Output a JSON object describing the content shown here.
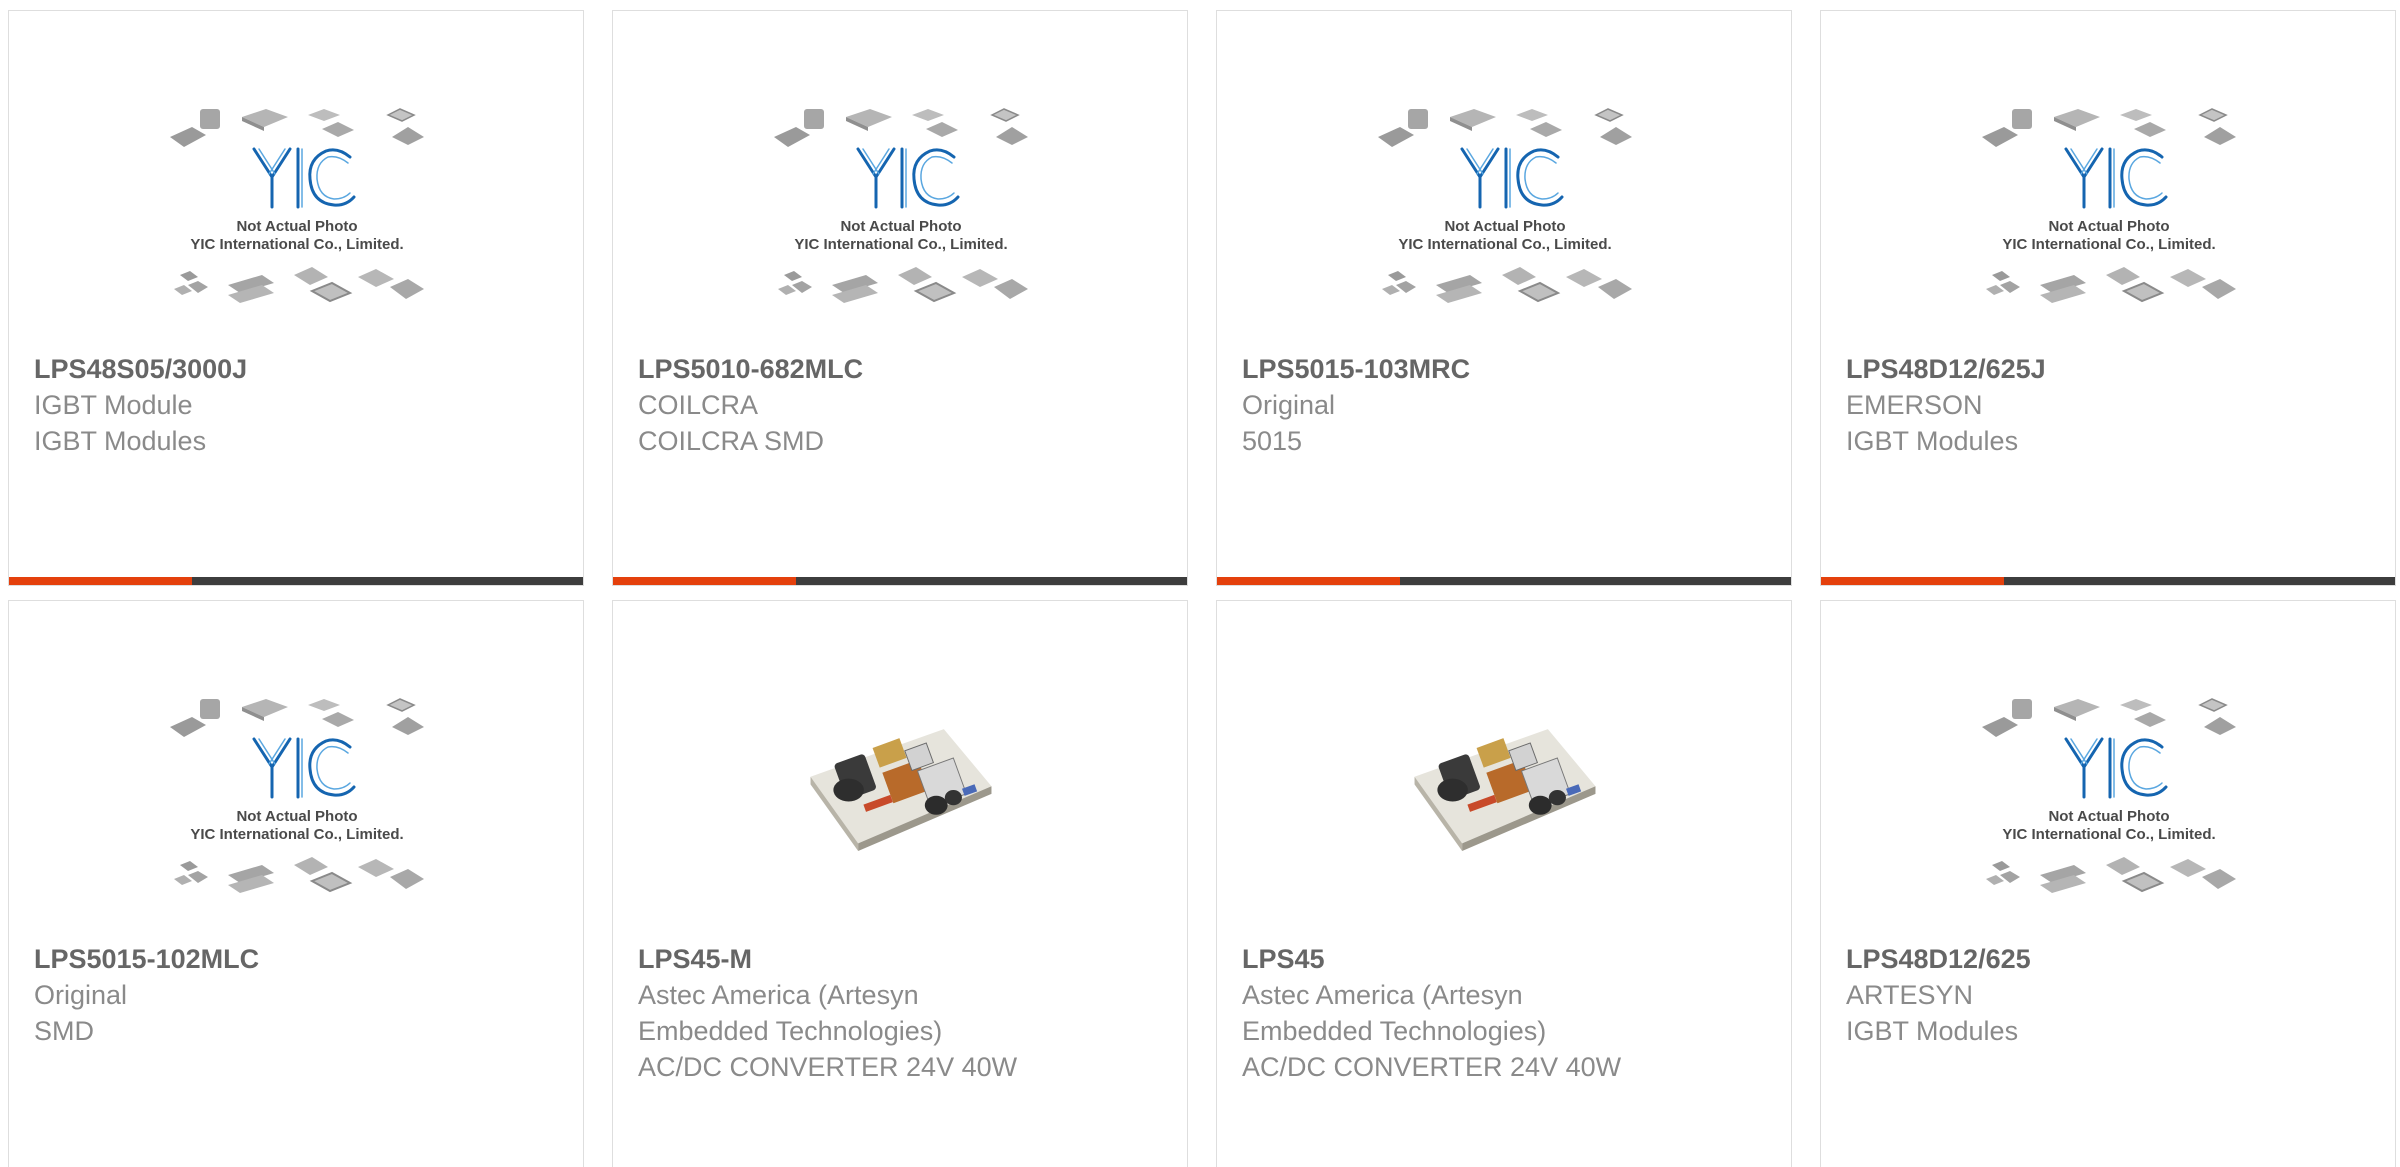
{
  "brand": {
    "accent_color": "#e4400c",
    "bar_color": "#3d3d3d",
    "logo_blue": "#1565b0"
  },
  "placeholder": {
    "logo_text": "YIC",
    "caption_line1": "Not Actual Photo",
    "caption_line2": "YIC International Co., Limited."
  },
  "products": [
    {
      "part_number": "LPS48S05/3000J",
      "manufacturer": "IGBT Module",
      "description": "IGBT Modules",
      "image": "placeholder-chips"
    },
    {
      "part_number": "LPS5010-682MLC",
      "manufacturer": "COILCRA",
      "description": "COILCRA SMD",
      "image": "placeholder-chips"
    },
    {
      "part_number": "LPS5015-103MRC",
      "manufacturer": "Original",
      "description": "5015",
      "image": "placeholder-chips"
    },
    {
      "part_number": "LPS48D12/625J",
      "manufacturer": "EMERSON",
      "description": "IGBT Modules",
      "image": "placeholder-chips"
    },
    {
      "part_number": "LPS5015-102MLC",
      "manufacturer": "Original",
      "description": "SMD",
      "image": "placeholder-chips"
    },
    {
      "part_number": "LPS45-M",
      "manufacturer_line1": "Astec America (Artesyn",
      "manufacturer_line2": "Embedded Technologies)",
      "description": "AC/DC CONVERTER 24V 40W",
      "image": "power-supply-photo"
    },
    {
      "part_number": "LPS45",
      "manufacturer_line1": "Astec America (Artesyn",
      "manufacturer_line2": "Embedded Technologies)",
      "description": "AC/DC CONVERTER 24V 40W",
      "image": "power-supply-photo"
    },
    {
      "part_number": "LPS48D12/625",
      "manufacturer": "ARTESYN",
      "description": "IGBT Modules",
      "image": "placeholder-chips"
    }
  ]
}
